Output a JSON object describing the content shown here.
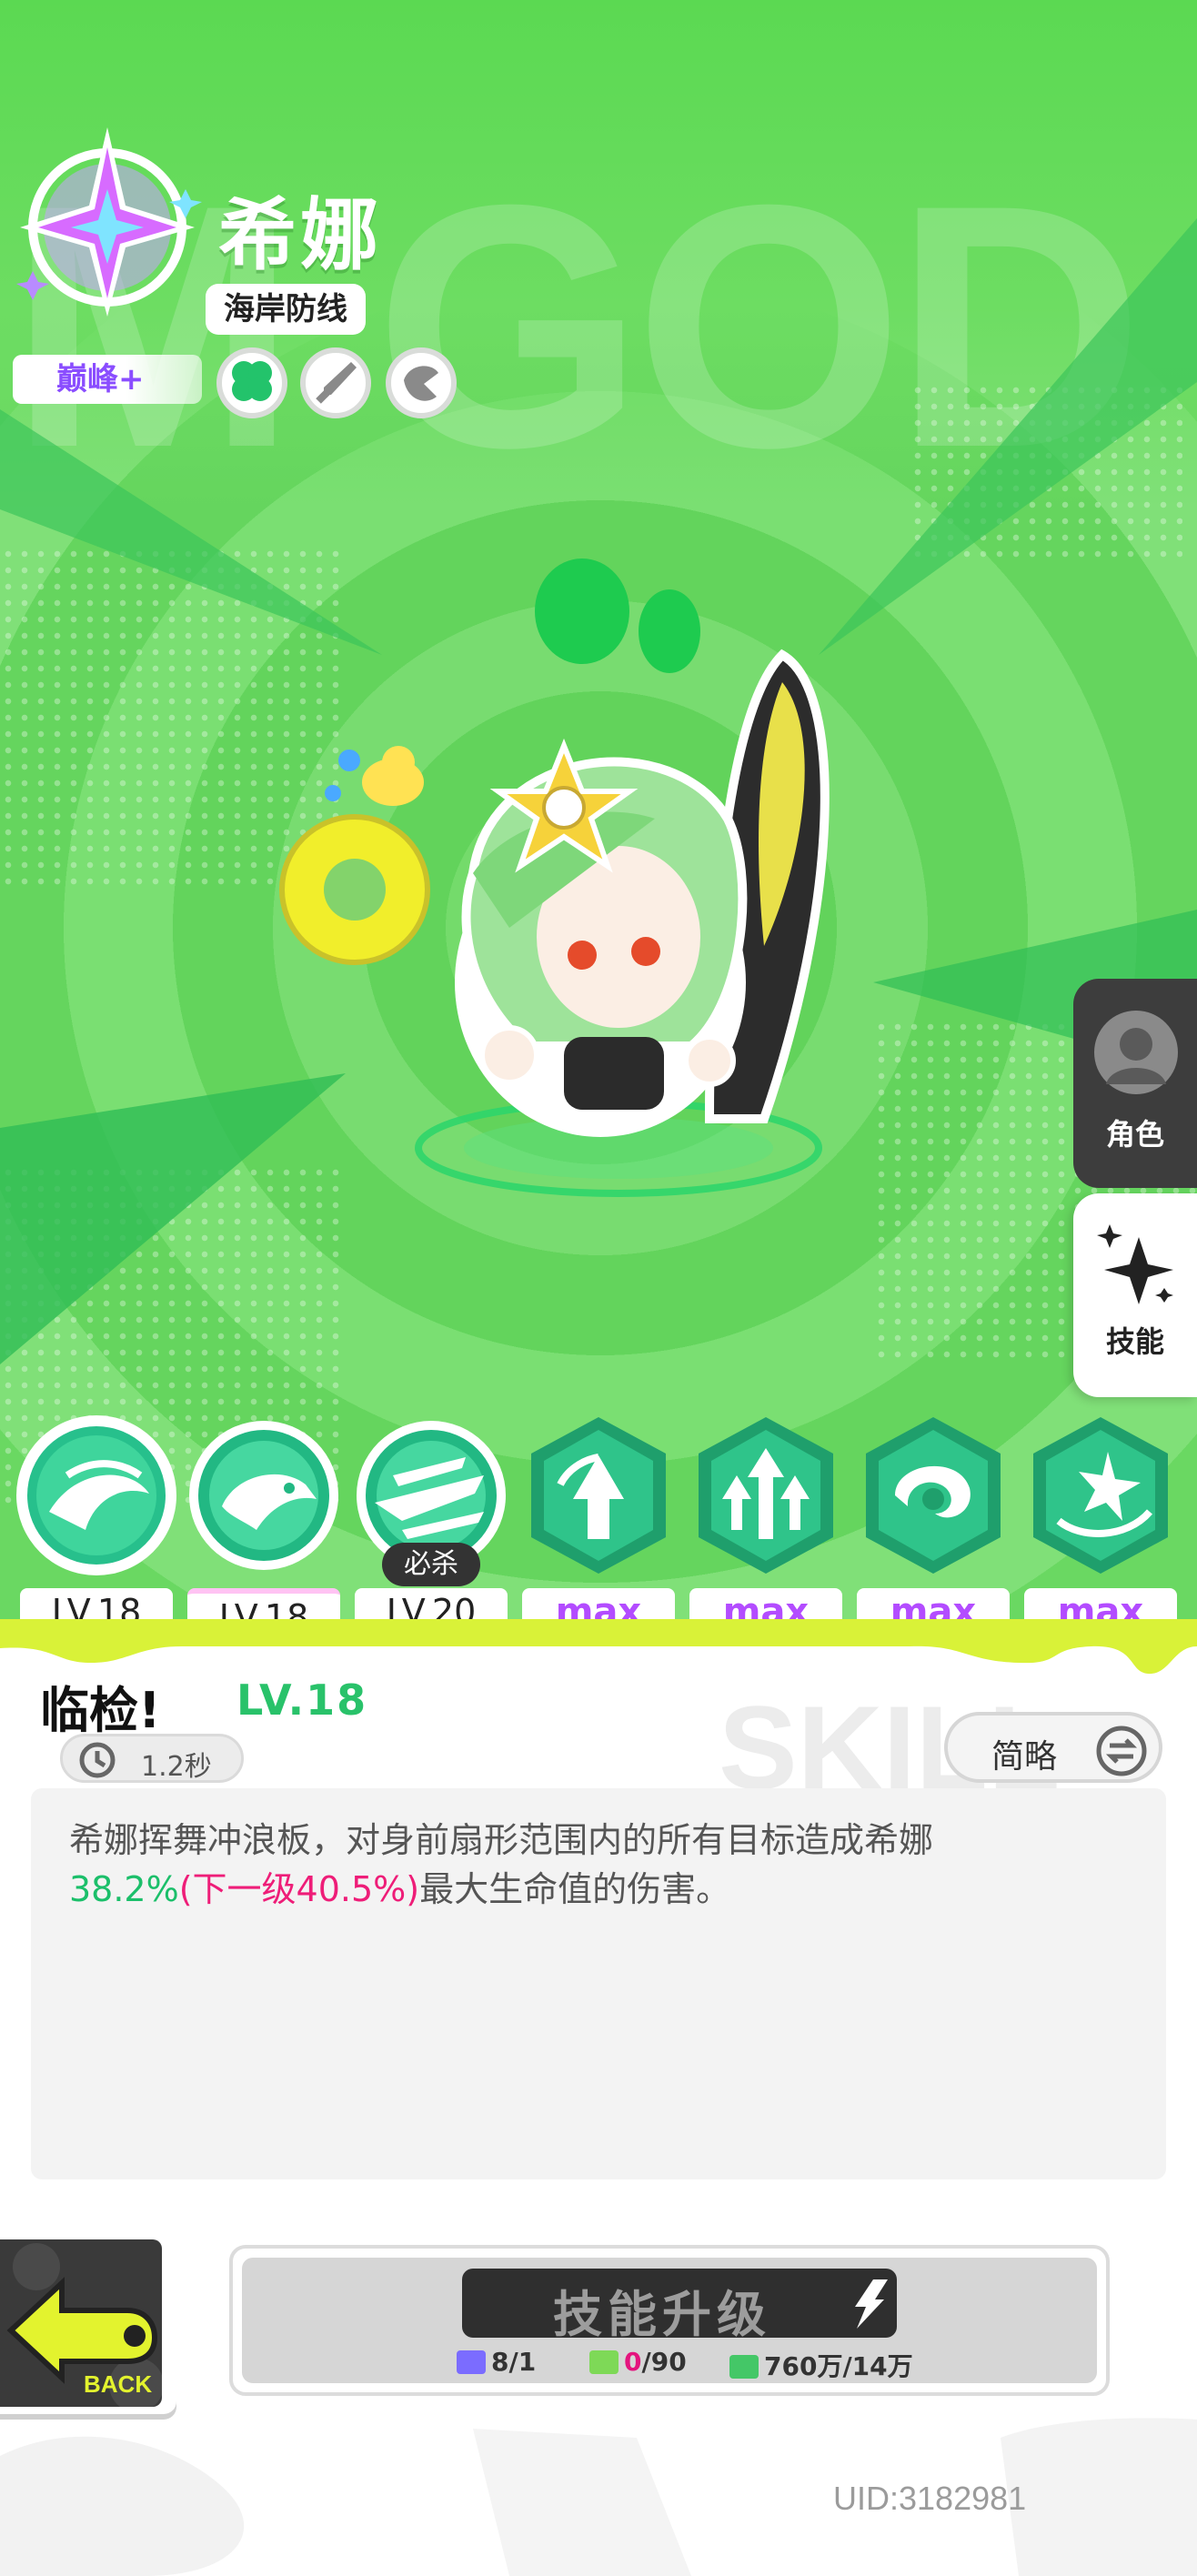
{
  "hero": {
    "name": "希娜",
    "tag": "海岸防线",
    "tier": "巅峰+",
    "background_word": "M GOD",
    "attribute_icons": [
      "clover-icon",
      "sword-icon",
      "leaf-emblem-icon"
    ]
  },
  "side_tabs": {
    "role_label": "角色",
    "skill_label": "技能"
  },
  "skills": [
    {
      "level": "LV.18",
      "icon": "fish-wave-icon",
      "selected": true
    },
    {
      "level": "LV.18",
      "icon": "shark-icon",
      "selected": false
    },
    {
      "level": "LV.20",
      "icon": "surf-slash-icon",
      "selected": false,
      "badge": "必杀"
    },
    {
      "level": "max",
      "icon": "arrow-burst-icon",
      "selected": false
    },
    {
      "level": "max",
      "icon": "triple-arrow-icon",
      "selected": false
    },
    {
      "level": "max",
      "icon": "swirl-icon",
      "selected": false
    },
    {
      "level": "max",
      "icon": "star-swirl-icon",
      "selected": false
    }
  ],
  "detail": {
    "skill_name": "临检!",
    "skill_level": "LV.18",
    "cooldown": "1.2秒",
    "brief_label": "简略",
    "background_word": "SKILL",
    "description_prefix": "希娜挥舞冲浪板，对身前扇形范围内的所有目标造成希娜",
    "description_value": "38.2%",
    "description_next": "(下一级40.5%)",
    "description_suffix": "最大生命值的伤害。"
  },
  "upgrade": {
    "label": "技能升级",
    "costs": [
      {
        "icon": "card-icon",
        "text": "8/1",
        "color": "#7b6cff"
      },
      {
        "icon": "ticket-icon",
        "have": "0",
        "need": "/90",
        "color": "#7ed957"
      },
      {
        "icon": "cash-icon",
        "text": "760万/14万",
        "color": "#44c767"
      }
    ]
  },
  "back_label": "BACK",
  "uid": "UID:3182981",
  "colors": {
    "scene_green": "#6ddd62",
    "level_green": "#29c26a",
    "max_purple": "#b34cff",
    "next_level_pink": "#ee1d78"
  }
}
